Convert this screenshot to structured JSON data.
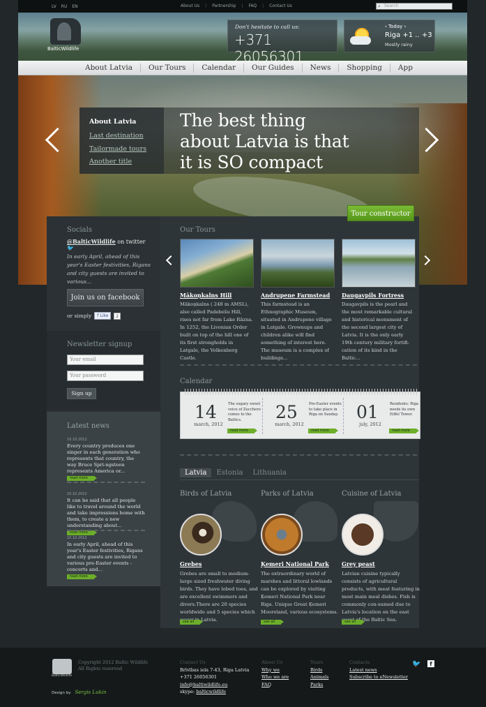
{
  "topbar": {
    "languages": [
      "LV",
      "RU",
      "EN"
    ],
    "links": [
      "About Us",
      "Partnership",
      "FAQ",
      "Contact Us"
    ],
    "search_placeholder": "Search"
  },
  "header": {
    "logo_text": "BalticWildlife",
    "call_label": "Don't hesitate to call us:",
    "phone": "+371 26056301",
    "weather": {
      "today": "‹  Today  ›",
      "temp": "Riga +1 .. +3",
      "desc": "Mostly rainy"
    }
  },
  "nav": [
    "About Latvia",
    "Our Tours",
    "Calendar",
    "Our Guides",
    "News",
    "Shopping",
    "App"
  ],
  "hero": {
    "menu": {
      "active": "About Latvia",
      "links": [
        "Last destination",
        "Tailormade tours",
        "Another title"
      ]
    },
    "quote_lines": [
      "The best thing",
      "about Latvia is that",
      "it is SO compact"
    ],
    "tour_button": "Tour constructor"
  },
  "sidebar": {
    "socials_title": "Socials",
    "twitter_handle": "@BalticWildlife",
    "twitter_suffix": "on twitter",
    "tweet": "In early April, ahead of this year's Easter festivities, Rigans and city guests are invited to various...",
    "facebook_button": "Join us on facebook",
    "or_simply": "or simply",
    "like": "Like",
    "like_count": "2",
    "newsletter_title": "Newsletter signup",
    "email_placeholder": "Your email",
    "password_placeholder": "Your password",
    "signup_button": "Sign up",
    "latest_title": "Latest news",
    "news": [
      {
        "date": "10.10.2012",
        "text": "Every country produces one singer in each generation who represents that country, the way Bruce Spri-ngsteen represents America or..."
      },
      {
        "date": "10.10.2012",
        "text": "It can be said that all people like to travel around the world and take impressions home with them, to create a new understanding about..."
      },
      {
        "date": "10.10.2012",
        "text": "In early April, ahead of this year's Easter festivities, Rigans and city guests are invited to various pre-Easter events - concerts and..."
      }
    ],
    "read_more": "read more"
  },
  "tours": {
    "title": "Our Tours",
    "items": [
      {
        "title": "Mākoņkalns Hill",
        "text": "Mākoņkalns ( 248 m AMSL), also called Padebešu Hill, rises not far from Lake Rāzna. In 1252, the Livonian Order built on top of the hill one of its first strongholds in Latgale, the Volkenberg Castle."
      },
      {
        "title": "Andrupene Farmstead",
        "text": "This farmstead is an Ethnographic Museum, situated in Andrupene village in Latgale. Grownups and children alike will find something of interest here. The museum is a complex of buildings..."
      },
      {
        "title": "Daugavpils Fortress",
        "text": "Daugavpils is the pearl and the most remarkable cultural and historical monument of the second largest city of Latvia. It is the only early 19th century military fortifi-cation of its kind in the Baltic..."
      }
    ]
  },
  "calendar": {
    "title": "Calendar",
    "events": [
      {
        "day": "14",
        "month": "march, 2012",
        "text": "The sugary sweet voice of Zucchero comes to the Baltics."
      },
      {
        "day": "25",
        "month": "march, 2012",
        "text": "Pre-Easter events to take place in Riga on Sunday."
      },
      {
        "day": "01",
        "month": "july, 2012",
        "text": "Residents: Riga needs its own Eiffel Tower."
      }
    ],
    "read_more": "read more"
  },
  "tabs": [
    "Latvia",
    "Estonia",
    "Lithuania"
  ],
  "categories": [
    {
      "heading": "Birds of Latvia",
      "title": "Grebes",
      "text": "Grebes are small to medium-large sized freshwater diving birds. They have lobed toes, and are excellent swimmers and divers.There are 20 species worldwide and 5 species which occur in Latvia."
    },
    {
      "heading": "Parks of Latvia",
      "title": "Ķemeri National Park",
      "text": "The extraordinary world of marshes and littoral lowlands can be explored by visiting Ķemeri National Park near Riga. Unique Great Ķemeri Mooreland, various ecosystems."
    },
    {
      "heading": "Cuisine of Latvia",
      "title": "Grey peast",
      "text": "Latvian cuisine typically consists of agricultural products, with meat featuring in most main meal dishes. Fish is commonly con-sumed due to Latvia's location on the east coast of the Baltic Sea."
    }
  ],
  "see_all": "see all",
  "footer": {
    "logo_text": "BalticWildlife",
    "copyright": [
      "Copyright 2012 Baltic Wildlife",
      "All Rights reserved"
    ],
    "design_by": "Design by",
    "designer": "Sergis Lukin",
    "contact_us": {
      "heading": "Contact Us",
      "address": "Brīvības iela 7-43, Riga Latvia",
      "phone": "+371 26056301",
      "email": "info@baltiwildlife.eu",
      "skype_label": "skype:",
      "skype": "balticwildlife"
    },
    "about_us": {
      "heading": "About Us",
      "links": [
        "Why we",
        "Who we are",
        "FAQ"
      ]
    },
    "tours": {
      "heading": "Tours",
      "links": [
        "Birds",
        "Animals",
        "Parks"
      ]
    },
    "contacts": {
      "heading": "Contacts",
      "links": [
        "Latest news",
        "Subscribe to eNewsletter"
      ]
    }
  }
}
